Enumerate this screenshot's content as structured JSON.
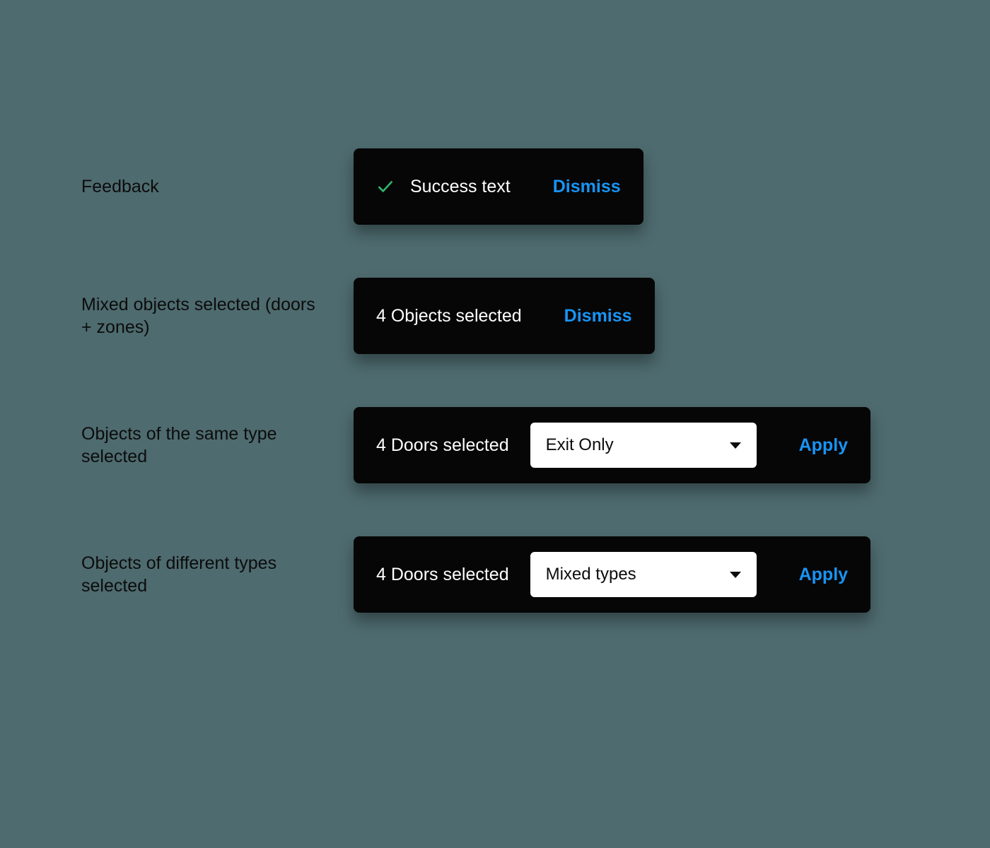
{
  "rows": {
    "feedback": {
      "label": "Feedback",
      "message": "Success text",
      "action": "Dismiss"
    },
    "mixed": {
      "label": "Mixed objects selected (doors + zones)",
      "message": "4 Objects selected",
      "action": "Dismiss"
    },
    "sameType": {
      "label": "Objects of the same type selected",
      "message": "4 Doors selected",
      "select": "Exit Only",
      "action": "Apply"
    },
    "diffType": {
      "label": "Objects of different types selected",
      "message": "4 Doors selected",
      "select": "Mixed types",
      "action": "Apply"
    }
  },
  "colors": {
    "background": "#4e6b6f",
    "toast": "#060606",
    "link": "#1894f5",
    "check": "#2fb36a"
  }
}
